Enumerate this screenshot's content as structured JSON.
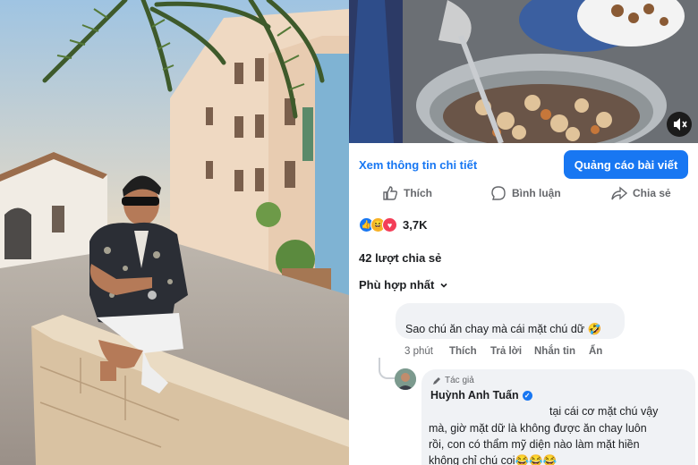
{
  "post": {
    "detail_link": "Xem thông tin chi tiết",
    "promote_button": "Quảng cáo bài viết",
    "actions": {
      "like": "Thích",
      "comment": "Bình luận",
      "share": "Chia sẻ"
    },
    "reaction_count": "3,7K",
    "share_count": "42 lượt chia sẻ",
    "sort_label": "Phù hợp nhất"
  },
  "comments": [
    {
      "text": "Sao chú ăn chay mà cái mặt chú dữ 🤣",
      "time": "3 phút",
      "actions": [
        "Thích",
        "Trả lời",
        "Nhắn tin",
        "Ẩn"
      ]
    },
    {
      "badge": "Tác giả",
      "author": "Huỳnh Anh Tuấn",
      "lines": [
        "tại cái cơ mặt chú vậy",
        "mà, giờ mặt dữ là không được ăn chay luôn",
        "rồi, con có thẩm mỹ diện nào làm mặt hiền",
        "không chỉ chú coi😂😂😂"
      ]
    }
  ],
  "icons": {
    "mute": "speaker-muted-icon",
    "like": "thumbs-up-icon",
    "comment": "speech-bubble-icon",
    "share": "share-arrow-icon",
    "sort": "chevron-down-icon",
    "badge": "pencil-icon",
    "verified": "verified-check-icon"
  },
  "colors": {
    "brand": "#1877f2",
    "muted_text": "#65676b",
    "bubble": "#f0f2f5"
  }
}
